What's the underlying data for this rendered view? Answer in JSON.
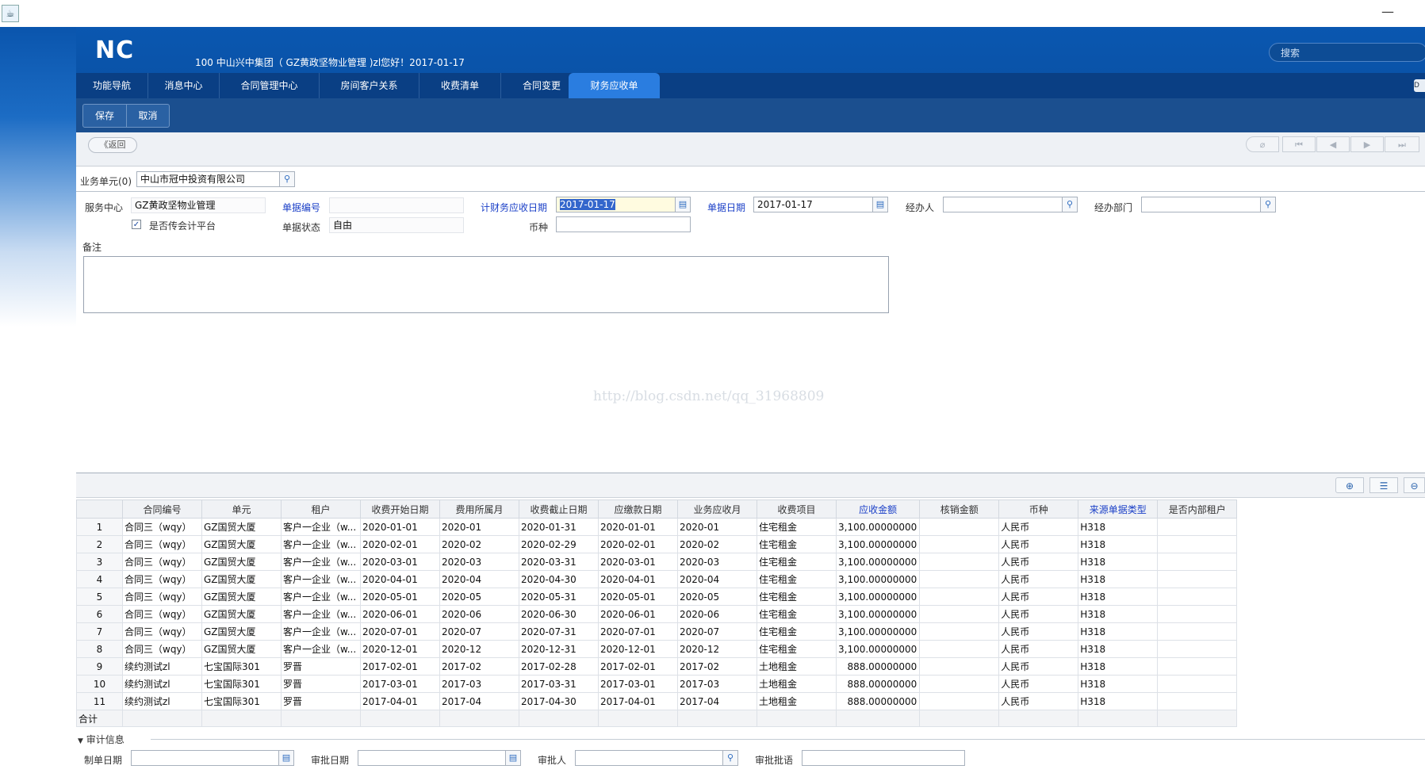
{
  "window": {
    "minimize_glyph": "—"
  },
  "header": {
    "logo": "NC",
    "greeting": "100 中山兴中集团（ GZ黄政坚物业管理 )zl您好！2017-01-17",
    "search_placeholder": "搜索"
  },
  "tabs": [
    {
      "label": "功能导航",
      "active": false
    },
    {
      "label": "消息中心",
      "active": false
    },
    {
      "label": "合同管理中心",
      "active": false
    },
    {
      "label": "房间客户关系",
      "active": false
    },
    {
      "label": "收费清单",
      "active": false
    },
    {
      "label": "合同变更",
      "active": false
    },
    {
      "label": "财务应收单",
      "active": true
    }
  ],
  "tab_overflow_glyph": "D",
  "toolbar": {
    "save_label": "保存",
    "cancel_label": "取消"
  },
  "nav": {
    "back_label": "《返回"
  },
  "form": {
    "org_label": "业务单元(0)",
    "org_value": "中山市冠中投资有限公司",
    "service_center_label": "服务中心",
    "service_center_value": "GZ黄政坚物业管理",
    "bill_no_label": "单据编号",
    "bill_no_value": "",
    "fin_date_label": "计财务应收日期",
    "fin_date_value": "2017-01-17",
    "bill_date_label": "单据日期",
    "bill_date_value": "2017-01-17",
    "handler_label": "经办人",
    "handler_value": "",
    "dept_label": "经办部门",
    "dept_value": "",
    "accounting_label": "是否传会计平台",
    "accounting_checked": true,
    "status_label": "单据状态",
    "status_value": "自由",
    "currency_label": "币种",
    "currency_value": "",
    "remarks_label": "备注",
    "remarks_value": ""
  },
  "watermark": "http://blog.csdn.net/qq_31968809",
  "grid": {
    "columns": [
      "",
      "合同编号",
      "单元",
      "租户",
      "收费开始日期",
      "费用所属月",
      "收费截止日期",
      "应缴款日期",
      "业务应收月",
      "收费项目",
      "应收金额",
      "核销金额",
      "币种",
      "来源单据类型",
      "是否内部租户"
    ],
    "rows": [
      [
        "1",
        "合同三（wqy）",
        "GZ国贸大厦",
        "客户一企业（w...",
        "2020-01-01",
        "2020-01",
        "2020-01-31",
        "2020-01-01",
        "2020-01",
        "住宅租金",
        "3,100.00000000",
        "",
        "人民币",
        "H318",
        ""
      ],
      [
        "2",
        "合同三（wqy）",
        "GZ国贸大厦",
        "客户一企业（w...",
        "2020-02-01",
        "2020-02",
        "2020-02-29",
        "2020-02-01",
        "2020-02",
        "住宅租金",
        "3,100.00000000",
        "",
        "人民币",
        "H318",
        ""
      ],
      [
        "3",
        "合同三（wqy）",
        "GZ国贸大厦",
        "客户一企业（w...",
        "2020-03-01",
        "2020-03",
        "2020-03-31",
        "2020-03-01",
        "2020-03",
        "住宅租金",
        "3,100.00000000",
        "",
        "人民币",
        "H318",
        ""
      ],
      [
        "4",
        "合同三（wqy）",
        "GZ国贸大厦",
        "客户一企业（w...",
        "2020-04-01",
        "2020-04",
        "2020-04-30",
        "2020-04-01",
        "2020-04",
        "住宅租金",
        "3,100.00000000",
        "",
        "人民币",
        "H318",
        ""
      ],
      [
        "5",
        "合同三（wqy）",
        "GZ国贸大厦",
        "客户一企业（w...",
        "2020-05-01",
        "2020-05",
        "2020-05-31",
        "2020-05-01",
        "2020-05",
        "住宅租金",
        "3,100.00000000",
        "",
        "人民币",
        "H318",
        ""
      ],
      [
        "6",
        "合同三（wqy）",
        "GZ国贸大厦",
        "客户一企业（w...",
        "2020-06-01",
        "2020-06",
        "2020-06-30",
        "2020-06-01",
        "2020-06",
        "住宅租金",
        "3,100.00000000",
        "",
        "人民币",
        "H318",
        ""
      ],
      [
        "7",
        "合同三（wqy）",
        "GZ国贸大厦",
        "客户一企业（w...",
        "2020-07-01",
        "2020-07",
        "2020-07-31",
        "2020-07-01",
        "2020-07",
        "住宅租金",
        "3,100.00000000",
        "",
        "人民币",
        "H318",
        ""
      ],
      [
        "8",
        "合同三（wqy）",
        "GZ国贸大厦",
        "客户一企业（w...",
        "2020-12-01",
        "2020-12",
        "2020-12-31",
        "2020-12-01",
        "2020-12",
        "住宅租金",
        "3,100.00000000",
        "",
        "人民币",
        "H318",
        ""
      ],
      [
        "9",
        "续约测试zl",
        "七宝国际301",
        "罗晋",
        "2017-02-01",
        "2017-02",
        "2017-02-28",
        "2017-02-01",
        "2017-02",
        "土地租金",
        "888.00000000",
        "",
        "人民币",
        "H318",
        ""
      ],
      [
        "10",
        "续约测试zl",
        "七宝国际301",
        "罗晋",
        "2017-03-01",
        "2017-03",
        "2017-03-31",
        "2017-03-01",
        "2017-03",
        "土地租金",
        "888.00000000",
        "",
        "人民币",
        "H318",
        ""
      ],
      [
        "11",
        "续约测试zl",
        "七宝国际301",
        "罗晋",
        "2017-04-01",
        "2017-04",
        "2017-04-30",
        "2017-04-01",
        "2017-04",
        "土地租金",
        "888.00000000",
        "",
        "人民币",
        "H318",
        ""
      ]
    ],
    "total_label": "合计"
  },
  "audit": {
    "section_label": "审计信息",
    "create_date_label": "制单日期",
    "approve_date_label": "审批日期",
    "approver_label": "审批人",
    "approve_note_label": "审批批语",
    "create_date_value": "",
    "approve_date_value": "",
    "approver_value": "",
    "approve_note_value": ""
  },
  "colors": {
    "header_blue": "#0a57b0",
    "tab_active": "#2a7de0",
    "label_blue": "#1a3fc7"
  },
  "icons": [
    "search-icon",
    "calendar-icon",
    "checkbox-check-icon",
    "first-page-icon",
    "previous-page-icon",
    "next-page-icon",
    "last-page-icon",
    "attachment-icon",
    "add-row-icon",
    "delete-row-icon"
  ]
}
